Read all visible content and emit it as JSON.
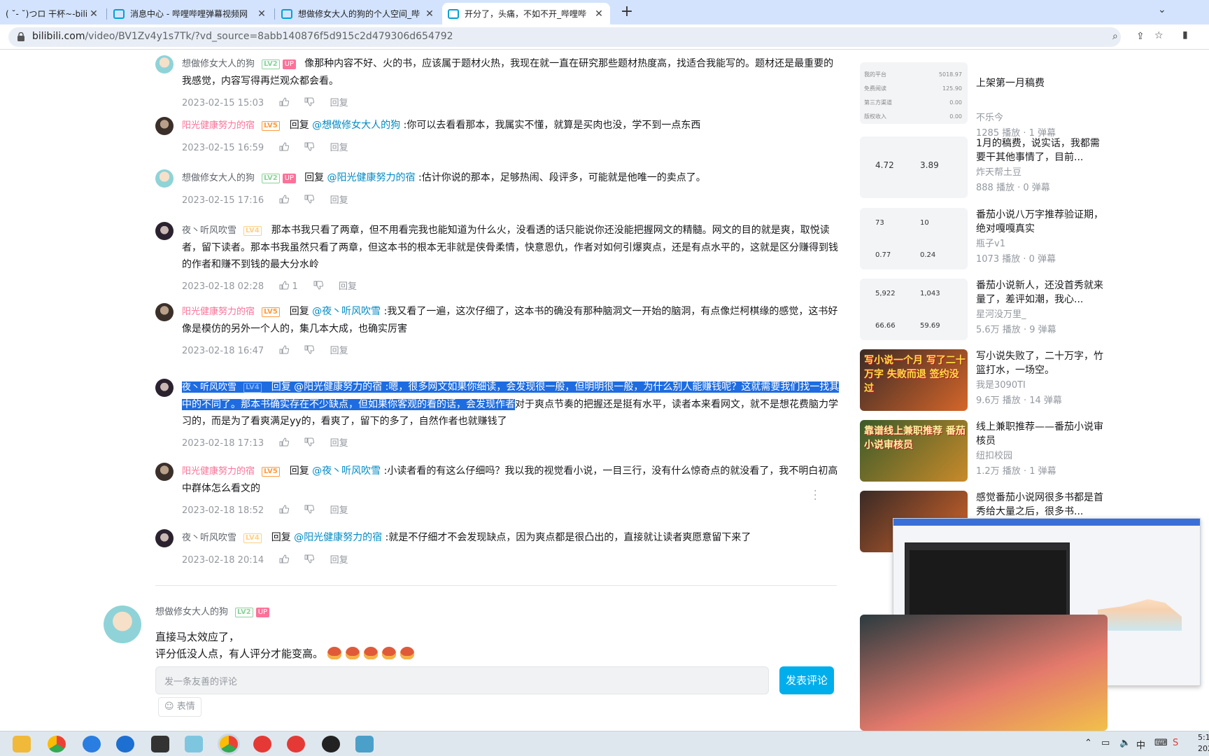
{
  "browser": {
    "tabs": [
      {
        "title": "( ˘- ˘)つロ 干杯~-bili",
        "active": false
      },
      {
        "title": "消息中心 - 哔哩哔哩弹幕视频网",
        "active": false
      },
      {
        "title": "想做修女大人的狗的个人空间_哔",
        "active": false
      },
      {
        "title": "开分了，头痛，不如不开_哔哩哔",
        "active": true
      }
    ],
    "new_tab": "+",
    "url_domain": "bilibili.com",
    "url_path": "/video/BV1Zv4y1s7Tk/?vd_source=8abb140876f5d915c2d479306d654792"
  },
  "replies": [
    {
      "user": "想做修女大人的狗",
      "level": "LV2",
      "up": "UP",
      "name_style": "gray",
      "avatar": "a1",
      "prefix": "",
      "mention": "",
      "text": "像那种内容不好、火的书，应该属于题材火热，我现在就一直在研究那些题材热度高，找适合我能写的。题材还是最重要的我感觉，内容写得再烂观众都会看。",
      "date": "2023-02-15 15:03",
      "likes": "",
      "reply_label": "回复"
    },
    {
      "user": "阳光健康努力的宿",
      "level": "LV5",
      "up": "",
      "name_style": "pink",
      "avatar": "a2",
      "prefix": "回复 ",
      "mention": "@想做修女大人的狗",
      "text": " :你可以去看看那本，我属实不懂，就算是买肉也没，学不到一点东西",
      "date": "2023-02-15 16:59",
      "likes": "",
      "reply_label": "回复"
    },
    {
      "user": "想做修女大人的狗",
      "level": "LV2",
      "up": "UP",
      "name_style": "gray",
      "avatar": "a1",
      "prefix": "回复 ",
      "mention": "@阳光健康努力的宿",
      "text": " :估计你说的那本，足够热闹、段评多，可能就是他唯一的卖点了。",
      "date": "2023-02-15 17:16",
      "likes": "",
      "reply_label": "回复"
    },
    {
      "user": "夜丶听风吹雪",
      "level": "LV4",
      "up": "",
      "name_style": "gray",
      "avatar": "a3",
      "prefix": "",
      "mention": "",
      "text": "那本书我只看了两章，但不用看完我也能知道为什么火，没看透的话只能说你还没能把握网文的精髓。网文的目的就是爽，取悦读者，留下读者。那本书我虽然只看了两章，但这本书的根本无非就是侠骨柔情，快意恩仇，作者对如何引爆爽点，还是有点水平的，这就是区分赚得到钱的作者和赚不到钱的最大分水岭",
      "date": "2023-02-18 02:28",
      "likes": "1",
      "reply_label": "回复"
    },
    {
      "user": "阳光健康努力的宿",
      "level": "LV5",
      "up": "",
      "name_style": "pink",
      "avatar": "a2",
      "prefix": "回复 ",
      "mention": "@夜丶听风吹雪",
      "text": " :我又看了一遍，这次仔细了，这本书的确没有那种脑洞文一开始的脑洞，有点像烂柯棋缘的感觉，这书好像是模仿的另外一个人的，集几本大成，也确实厉害",
      "date": "2023-02-18 16:47",
      "likes": "",
      "reply_label": "回复"
    },
    {
      "user": "夜丶听风吹雪",
      "level": "LV4",
      "up": "",
      "name_style": "gray",
      "avatar": "a3",
      "prefix": "回复 ",
      "mention": "@阳光健康努力的宿",
      "text_selected": " :嗯，很多网文如果你细读，会发现很一般，但明明很一般，为什么别人能赚钱呢？这就需要我们找一找其中的不同了。那本书确实存在不少缺点，但如果你客观的看的话，会发现作者",
      "text": "对于爽点节奏的把握还是挺有水平，读者本来看网文，就不是想花费脑力学习的，而是为了看爽满足yy的，看爽了，留下的多了，自然作者也就赚钱了",
      "date": "2023-02-18 17:13",
      "likes": "",
      "reply_label": "回复"
    },
    {
      "user": "阳光健康努力的宿",
      "level": "LV5",
      "up": "",
      "name_style": "pink",
      "avatar": "a2",
      "prefix": "回复 ",
      "mention": "@夜丶听风吹雪",
      "text": " :小读者看的有这么仔细吗？我以我的视觉看小说，一目三行，没有什么惊奇点的就没看了，我不明白初高中群体怎么看文的",
      "date": "2023-02-18 18:52",
      "likes": "",
      "reply_label": "回复"
    },
    {
      "user": "夜丶听风吹雪",
      "level": "LV4",
      "up": "",
      "name_style": "gray",
      "avatar": "a3",
      "prefix": "回复 ",
      "mention": "@阳光健康努力的宿",
      "text": " :就是不仔细才不会发现缺点，因为爽点都是很凸出的，直接就让读者爽愿意留下来了",
      "date": "2023-02-18 20:14",
      "likes": "",
      "reply_label": "回复"
    }
  ],
  "main_comment": {
    "user": "想做修女大人的狗",
    "level": "LV2",
    "up": "UP",
    "line1": "直接马太效应了，",
    "line2": "评分低没人点，有人评分才能变高。"
  },
  "composer": {
    "placeholder": "发一条友善的评论",
    "submit": "发表评论",
    "emoji": "表情"
  },
  "recommendations": [
    {
      "title": "上架第一月稿费",
      "author": "不乐今",
      "stats": "1285 播放 · 1 弹幕",
      "thumb": "light",
      "thumb_rows": [
        [
          "我的平台",
          "5018.97"
        ],
        [
          "免费阅读",
          "125.90"
        ],
        [
          "第三方渠道",
          "0.00"
        ],
        [
          "版权收入",
          "0.00"
        ]
      ]
    },
    {
      "title": "1月的稿费，说实话，我都需要干其他事情了，目前...",
      "author": "炸天帮土豆",
      "stats": "888 播放 · 0 弹幕",
      "thumb": "light",
      "thumb_nums": [
        "4.72",
        "3.89"
      ]
    },
    {
      "title": "番茄小说八万字推荐验证期，绝对嘎嘎真实",
      "author": "瓶子v1",
      "stats": "1073 播放 · 0 弹幕",
      "thumb": "light",
      "thumb_nums": [
        "73",
        "10",
        "0.77",
        "0.24"
      ]
    },
    {
      "title": "番茄小说新人，还没首秀就来量了，差评如潮，我心...",
      "author": "星河没万里_",
      "stats": "5.6万 播放 · 9 弹幕",
      "thumb": "light",
      "thumb_nums": [
        "5,922",
        "1,043",
        "66.66",
        "59.69"
      ]
    },
    {
      "title": "写小说失败了，二十万字，竹篮打水，一场空。",
      "author": "我是3090TI",
      "stats": "9.6万 播放 · 14 弹幕",
      "thumb": "orange",
      "thumb_caption": "写小说一个月 写了二十万字 失败而退 签约没过"
    },
    {
      "title": "线上兼职推荐——番茄小说审核员",
      "author": "纽扣校园",
      "stats": "1.2万 播放 · 1 弹幕",
      "thumb": "dark",
      "thumb_caption": "靠谱线上兼职推荐 番茄小说审核员"
    },
    {
      "title": "感觉番茄小说网很多书都是首秀给大量之后，很多书...",
      "author": "",
      "stats": "",
      "thumb": "light"
    }
  ],
  "taskbar": {
    "tray": [
      "中"
    ],
    "clock_time": "5:1",
    "clock_date": "202"
  }
}
